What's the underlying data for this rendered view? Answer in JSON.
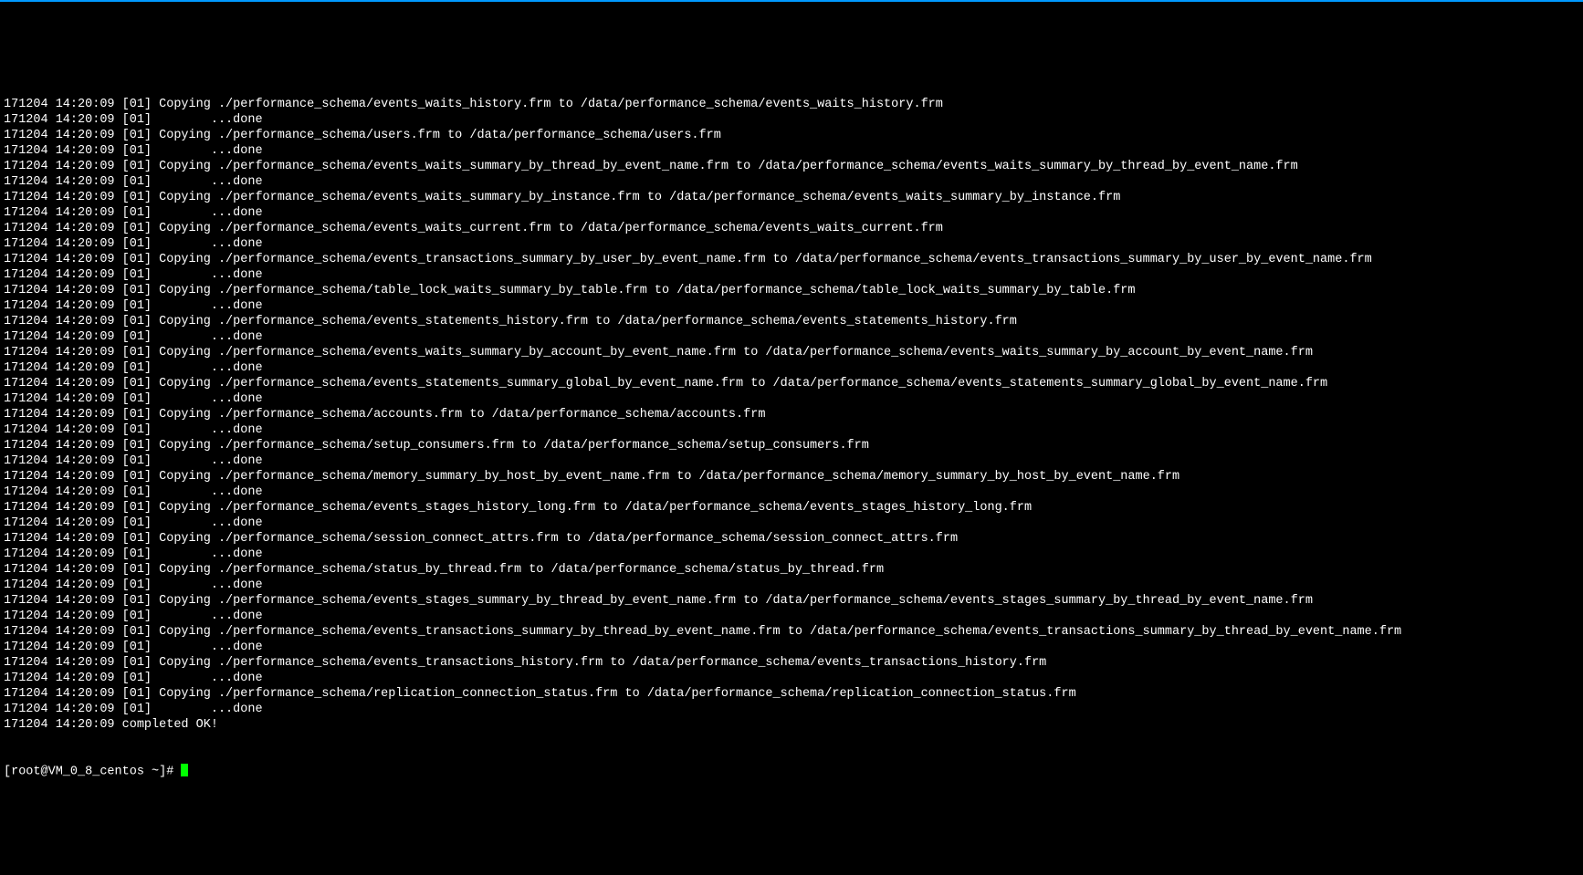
{
  "lines": [
    "171204 14:20:09 [01] Copying ./performance_schema/events_waits_history.frm to /data/performance_schema/events_waits_history.frm",
    "171204 14:20:09 [01]        ...done",
    "171204 14:20:09 [01] Copying ./performance_schema/users.frm to /data/performance_schema/users.frm",
    "171204 14:20:09 [01]        ...done",
    "171204 14:20:09 [01] Copying ./performance_schema/events_waits_summary_by_thread_by_event_name.frm to /data/performance_schema/events_waits_summary_by_thread_by_event_name.frm",
    "171204 14:20:09 [01]        ...done",
    "171204 14:20:09 [01] Copying ./performance_schema/events_waits_summary_by_instance.frm to /data/performance_schema/events_waits_summary_by_instance.frm",
    "171204 14:20:09 [01]        ...done",
    "171204 14:20:09 [01] Copying ./performance_schema/events_waits_current.frm to /data/performance_schema/events_waits_current.frm",
    "171204 14:20:09 [01]        ...done",
    "171204 14:20:09 [01] Copying ./performance_schema/events_transactions_summary_by_user_by_event_name.frm to /data/performance_schema/events_transactions_summary_by_user_by_event_name.frm",
    "171204 14:20:09 [01]        ...done",
    "171204 14:20:09 [01] Copying ./performance_schema/table_lock_waits_summary_by_table.frm to /data/performance_schema/table_lock_waits_summary_by_table.frm",
    "171204 14:20:09 [01]        ...done",
    "171204 14:20:09 [01] Copying ./performance_schema/events_statements_history.frm to /data/performance_schema/events_statements_history.frm",
    "171204 14:20:09 [01]        ...done",
    "171204 14:20:09 [01] Copying ./performance_schema/events_waits_summary_by_account_by_event_name.frm to /data/performance_schema/events_waits_summary_by_account_by_event_name.frm",
    "171204 14:20:09 [01]        ...done",
    "171204 14:20:09 [01] Copying ./performance_schema/events_statements_summary_global_by_event_name.frm to /data/performance_schema/events_statements_summary_global_by_event_name.frm",
    "171204 14:20:09 [01]        ...done",
    "171204 14:20:09 [01] Copying ./performance_schema/accounts.frm to /data/performance_schema/accounts.frm",
    "171204 14:20:09 [01]        ...done",
    "171204 14:20:09 [01] Copying ./performance_schema/setup_consumers.frm to /data/performance_schema/setup_consumers.frm",
    "171204 14:20:09 [01]        ...done",
    "171204 14:20:09 [01] Copying ./performance_schema/memory_summary_by_host_by_event_name.frm to /data/performance_schema/memory_summary_by_host_by_event_name.frm",
    "171204 14:20:09 [01]        ...done",
    "171204 14:20:09 [01] Copying ./performance_schema/events_stages_history_long.frm to /data/performance_schema/events_stages_history_long.frm",
    "171204 14:20:09 [01]        ...done",
    "171204 14:20:09 [01] Copying ./performance_schema/session_connect_attrs.frm to /data/performance_schema/session_connect_attrs.frm",
    "171204 14:20:09 [01]        ...done",
    "171204 14:20:09 [01] Copying ./performance_schema/status_by_thread.frm to /data/performance_schema/status_by_thread.frm",
    "171204 14:20:09 [01]        ...done",
    "171204 14:20:09 [01] Copying ./performance_schema/events_stages_summary_by_thread_by_event_name.frm to /data/performance_schema/events_stages_summary_by_thread_by_event_name.frm",
    "171204 14:20:09 [01]        ...done",
    "171204 14:20:09 [01] Copying ./performance_schema/events_transactions_summary_by_thread_by_event_name.frm to /data/performance_schema/events_transactions_summary_by_thread_by_event_name.frm",
    "171204 14:20:09 [01]        ...done",
    "171204 14:20:09 [01] Copying ./performance_schema/events_transactions_history.frm to /data/performance_schema/events_transactions_history.frm",
    "171204 14:20:09 [01]        ...done",
    "171204 14:20:09 [01] Copying ./performance_schema/replication_connection_status.frm to /data/performance_schema/replication_connection_status.frm",
    "171204 14:20:09 [01]        ...done",
    "171204 14:20:09 completed OK!"
  ],
  "prompt": "[root@VM_0_8_centos ~]# "
}
